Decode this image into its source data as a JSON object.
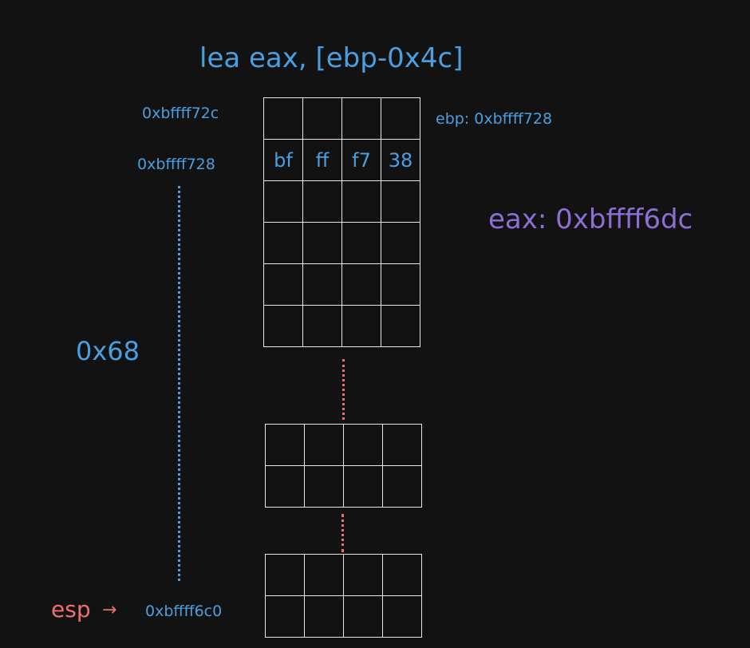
{
  "title": "lea eax, [ebp-0x4c]",
  "addresses": {
    "top": "0xbffff72c",
    "ebp_addr": "0xbffff728",
    "esp_addr": "0xbffff6c0"
  },
  "ebp_label": "ebp: 0xbffff728",
  "eax_label": "eax: 0xbffff6dc",
  "offset_label": "0x68",
  "esp_label": "esp",
  "arrow": "→",
  "bytes": [
    "bf",
    "ff",
    "f7",
    "38"
  ],
  "colors": {
    "background": "#121212",
    "blue": "#4a9fe0",
    "purple": "#8b6fd6",
    "red": "#ef6f6f",
    "cell_border": "#e8e8e8"
  }
}
